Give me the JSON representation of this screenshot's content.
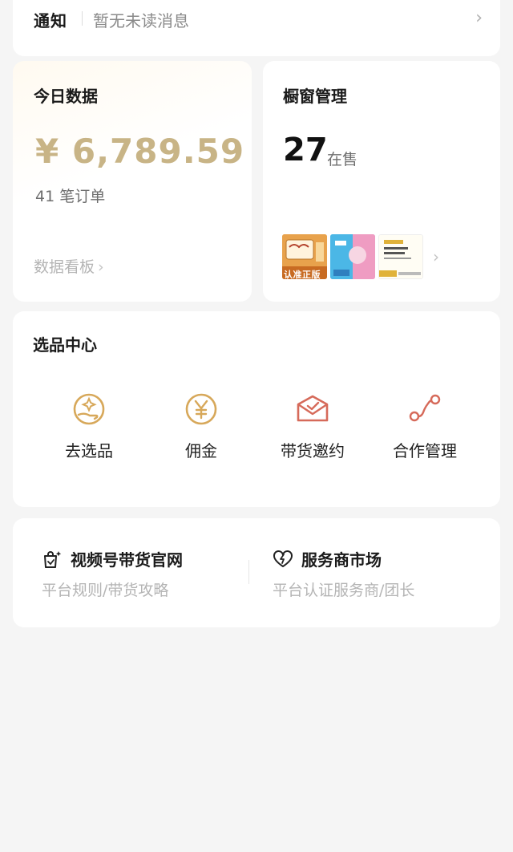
{
  "notice": {
    "title": "通知",
    "message": "暂无未读消息",
    "chevron": "›"
  },
  "today": {
    "title": "今日数据",
    "amount": "¥ 6,789.59",
    "orders": "41 笔订单",
    "link": "数据看板",
    "chevron": "›"
  },
  "showcase": {
    "title": "橱窗管理",
    "count": "27",
    "unit": "在售",
    "chevron": "›",
    "book1_badge": "认准正版"
  },
  "selection": {
    "title": "选品中心",
    "items": [
      {
        "label": "去选品",
        "icon": "hand-sparkle-icon"
      },
      {
        "label": "佣金",
        "icon": "yen-circle-icon"
      },
      {
        "label": "带货邀约",
        "icon": "envelope-check-icon"
      },
      {
        "label": "合作管理",
        "icon": "connection-nodes-icon"
      }
    ]
  },
  "links": [
    {
      "name": "视频号带货官网",
      "sub": "平台规则/带货攻略",
      "icon": "shopping-bag-sparkle-icon"
    },
    {
      "name": "服务商市场",
      "sub": "平台认证服务商/团长",
      "icon": "heart-bolt-icon"
    }
  ],
  "colors": {
    "accent_gold": "#c8b486",
    "icon_gold": "#d7a85a",
    "icon_red": "#d66a5a"
  }
}
